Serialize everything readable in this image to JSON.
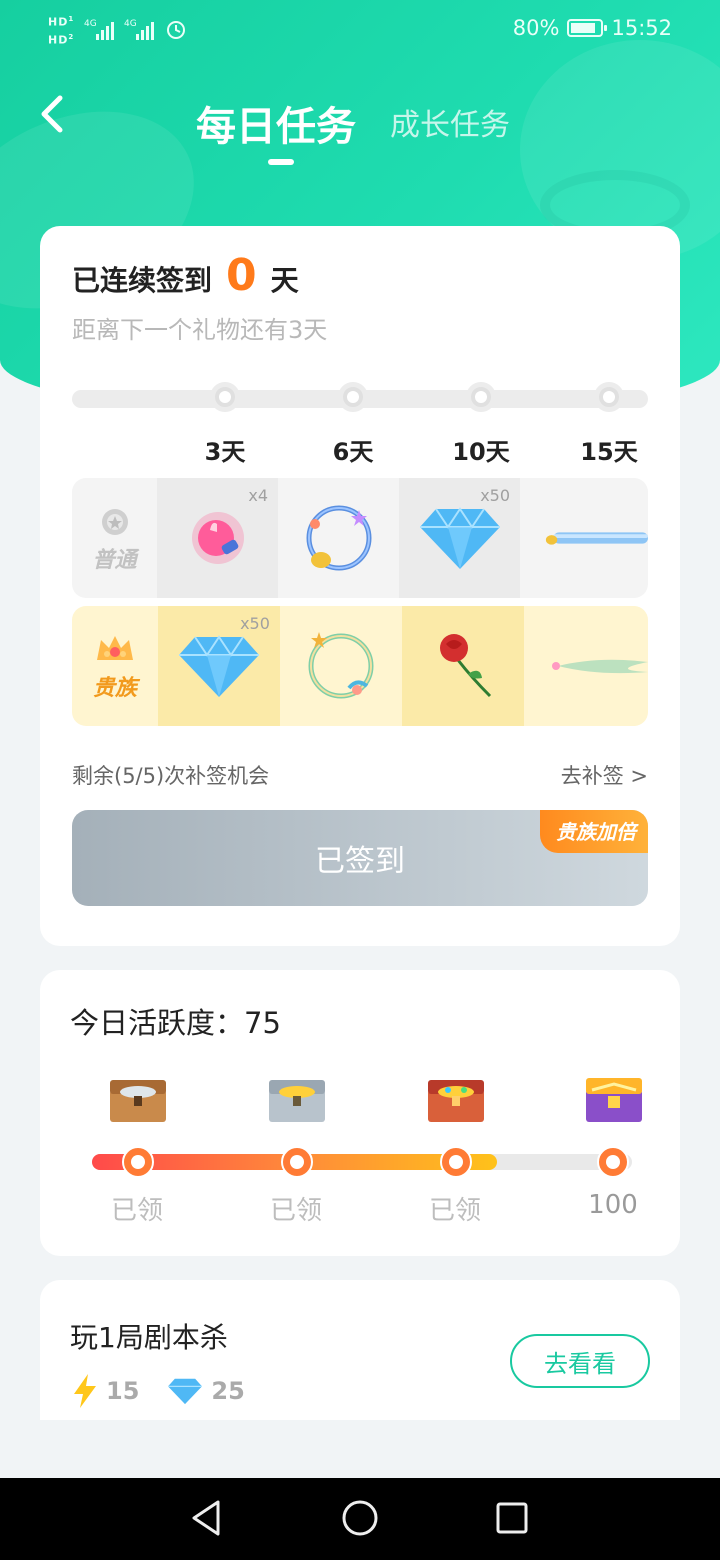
{
  "status_bar": {
    "network_left": "HD\nHD",
    "signal": "4G 4G",
    "battery": "80%",
    "time": "15:52"
  },
  "header": {
    "tab_daily": "每日任务",
    "tab_growth": "成长任务"
  },
  "checkin": {
    "prefix": "已连续签到",
    "days": "0",
    "suffix": "天",
    "subtitle": "距离下一个礼物还有3天",
    "milestones": [
      "3天",
      "6天",
      "10天",
      "15天"
    ],
    "normal_label": "普通",
    "noble_label": "贵族",
    "normal_rewards": [
      {
        "icon": "thumbs-up-icon",
        "qty": "x4"
      },
      {
        "icon": "avatar-frame-icon",
        "qty": ""
      },
      {
        "icon": "diamond-icon",
        "qty": "x50"
      },
      {
        "icon": "name-bar-icon",
        "qty": ""
      }
    ],
    "noble_rewards": [
      {
        "icon": "diamond-icon",
        "qty": "x50"
      },
      {
        "icon": "avatar-frame-icon",
        "qty": ""
      },
      {
        "icon": "rose-icon",
        "qty": ""
      },
      {
        "icon": "comet-icon",
        "qty": ""
      }
    ],
    "makeup_text": "剩余(5/5)次补签机会",
    "makeup_link": "去补签 >",
    "signed_button": "已签到",
    "noble_badge": "贵族加倍"
  },
  "activity": {
    "title": "今日活跃度：75",
    "progress_fraction": 0.75,
    "labels": [
      "已领",
      "已领",
      "已领",
      "100"
    ]
  },
  "task": {
    "title": "玩1局剧本杀",
    "energy": "15",
    "diamonds": "25",
    "button": "去看看"
  }
}
